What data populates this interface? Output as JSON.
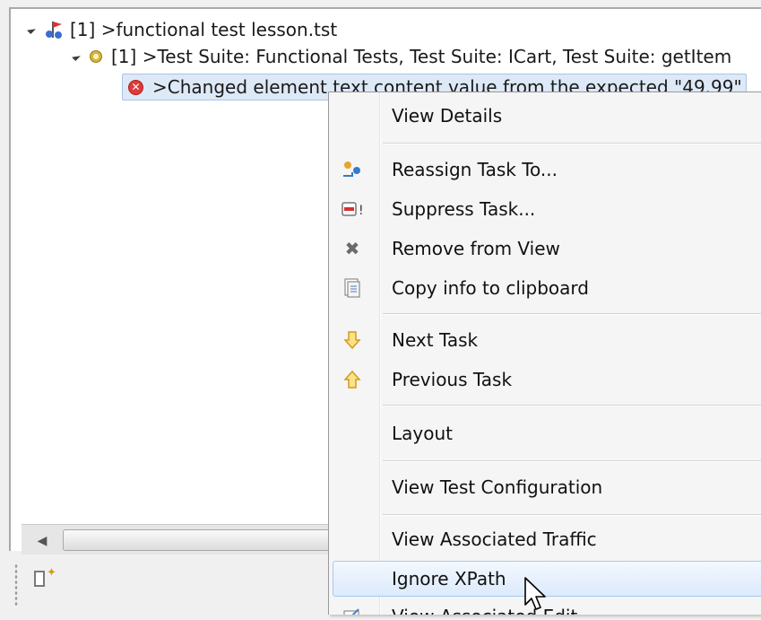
{
  "tree": {
    "root_label": "[1] >functional test lesson.tst",
    "suite_label": "[1] >Test Suite: Functional Tests, Test Suite: ICart, Test Suite: getItem",
    "task_label": ">Changed element text content value from the expected \"49.99\""
  },
  "context_menu": {
    "items": [
      {
        "label": "View Details",
        "icon": ""
      },
      {
        "label": "Reassign Task To...",
        "icon": "reassign-icon"
      },
      {
        "label": "Suppress Task...",
        "icon": "suppress-icon"
      },
      {
        "label": "Remove from View",
        "icon": "remove-icon"
      },
      {
        "label": "Copy info to clipboard",
        "icon": "clipboard-icon"
      },
      {
        "label": "Next Task",
        "icon": "arrow-down-icon"
      },
      {
        "label": "Previous Task",
        "icon": "arrow-up-icon"
      },
      {
        "label": "Layout",
        "icon": ""
      },
      {
        "label": "View Test Configuration",
        "icon": ""
      },
      {
        "label": "View Associated Traffic",
        "icon": ""
      },
      {
        "label": "Ignore XPath",
        "icon": ""
      },
      {
        "label": "View Associated Edit",
        "icon": "edit-icon"
      }
    ]
  },
  "colors": {
    "selection": "#dde9f7",
    "error": "#e03a3a",
    "menu_bg": "#f5f5f5",
    "hover": "#dceafc"
  }
}
